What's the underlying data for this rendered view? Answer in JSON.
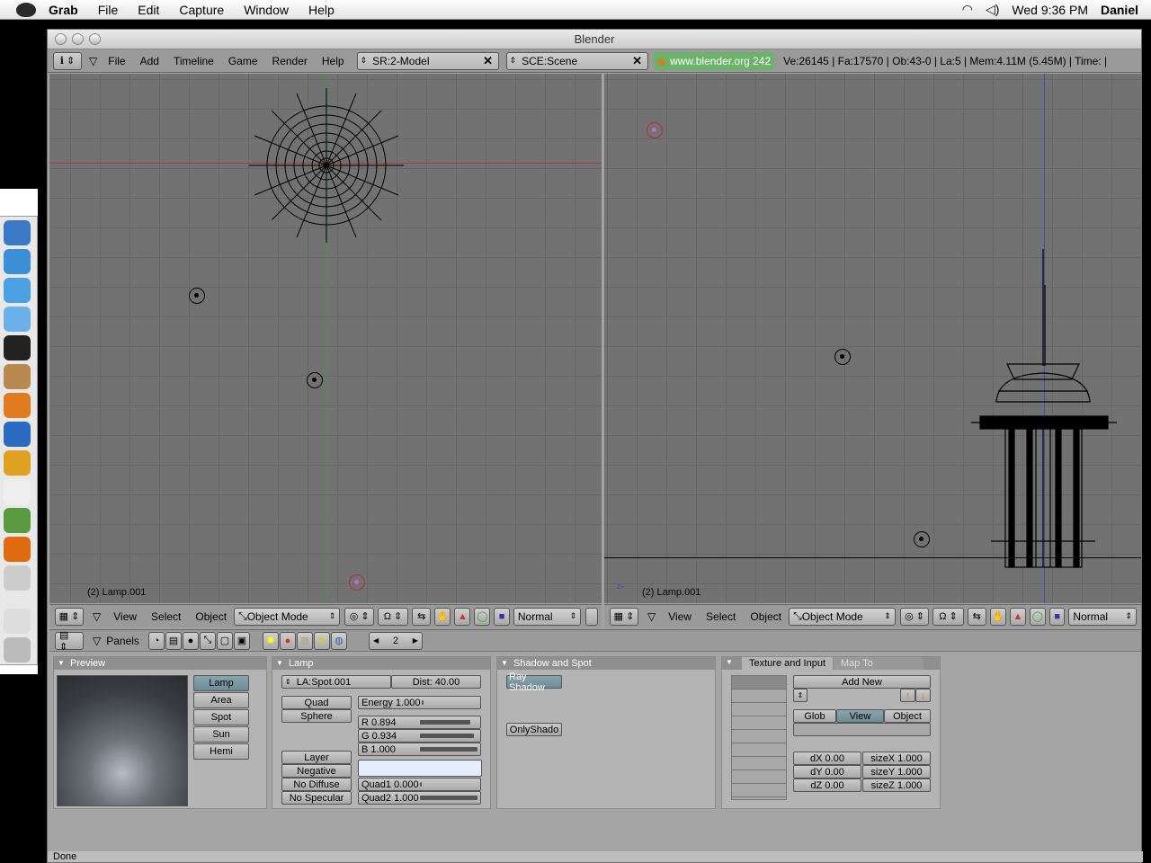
{
  "menubar": {
    "app": "Grab",
    "items": [
      "File",
      "Edit",
      "Capture",
      "Window",
      "Help"
    ],
    "clock": "Wed 9:36 PM",
    "user": "Daniel"
  },
  "window": {
    "title": "Blender"
  },
  "infobar": {
    "menus": [
      "File",
      "Add",
      "Timeline",
      "Game",
      "Render",
      "Help"
    ],
    "screen": "SR:2-Model",
    "scene": "SCE:Scene",
    "url": "www.blender.org 242",
    "stats": "Ve:26145 | Fa:17570 | Ob:43-0 | La:5  | Mem:4.11M (5.45M)  | Time: |"
  },
  "viewport_left": {
    "label": "(2) Lamp.001"
  },
  "viewport_right": {
    "label": "(2) Lamp.001"
  },
  "viewheader": {
    "menus": [
      "View",
      "Select",
      "Object"
    ],
    "mode": "Object Mode",
    "shading": "Normal"
  },
  "buttons_header": {
    "panels_label": "Panels",
    "frame": "2"
  },
  "preview_panel": {
    "title": "Preview",
    "types": [
      "Lamp",
      "Area",
      "Spot",
      "Sun",
      "Hemi"
    ]
  },
  "lamp_panel": {
    "title": "Lamp",
    "name": "LA:Spot.001",
    "dist": "Dist: 40.00",
    "quad": "Quad",
    "sphere": "Sphere",
    "energy": "Energy 1.000",
    "r": "R 0.894",
    "g": "G 0.934",
    "b": "B 1.000",
    "layer": "Layer",
    "negative": "Negative",
    "no_diffuse": "No Diffuse",
    "no_specular": "No Specular",
    "quad1": "Quad1 0.000",
    "quad2": "Quad2 1.000",
    "color": "#e4eeff"
  },
  "shadow_panel": {
    "title": "Shadow and Spot",
    "ray_shadow": "Ray Shadow",
    "only_shadow": "OnlyShado"
  },
  "texture_panel": {
    "tab1": "Texture and Input",
    "tab2": "Map To",
    "add_new": "Add New",
    "glob": "Glob",
    "view": "View",
    "object": "Object",
    "dx": "dX 0.00",
    "dy": "dY 0.00",
    "dz": "dZ 0.00",
    "sizex": "sizeX 1.000",
    "sizey": "sizeY 1.000",
    "sizez": "sizeZ 1.000"
  },
  "status": "Done"
}
